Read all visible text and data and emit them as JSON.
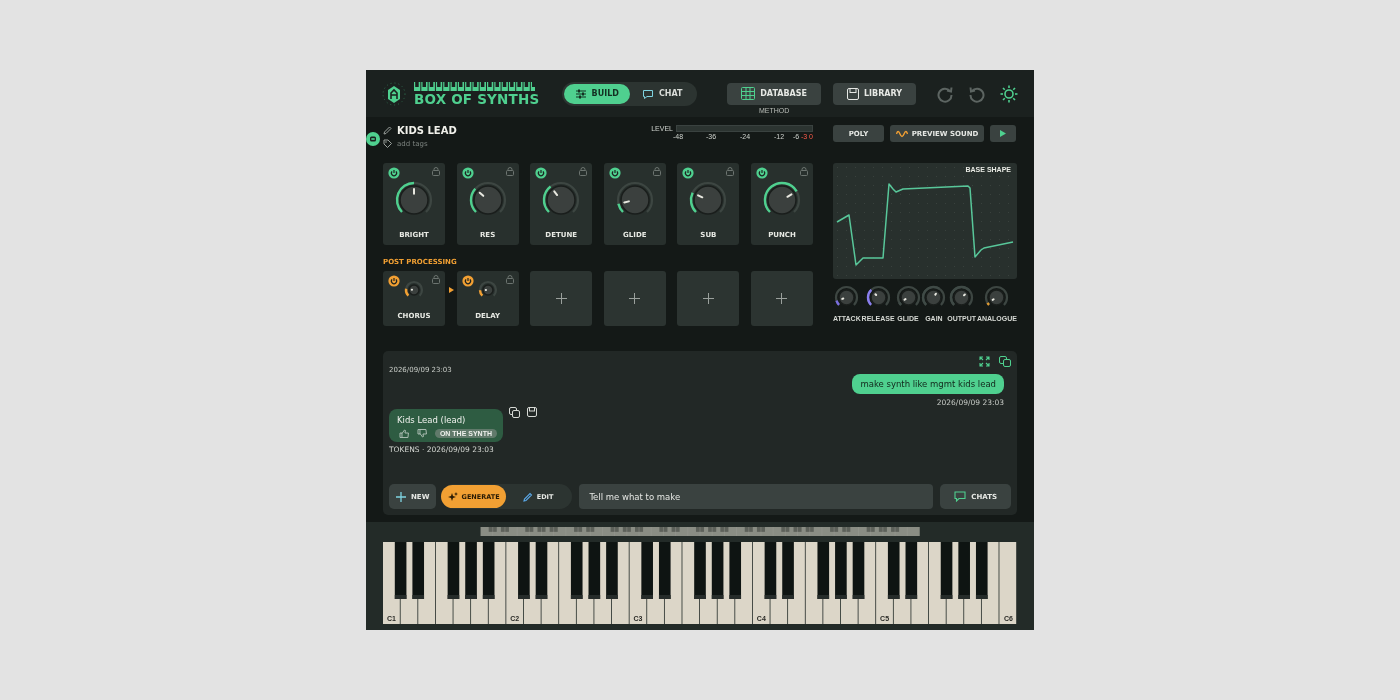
{
  "header": {
    "title": "BOX OF SYNTHS",
    "mode_tabs": [
      {
        "label": "BUILD",
        "selected": true,
        "kind": "build"
      },
      {
        "label": "CHAT",
        "selected": false,
        "kind": "chat"
      }
    ],
    "buttons": [
      {
        "label": "DATABASE",
        "caption": "METHOD",
        "kind": "database"
      },
      {
        "label": "LIBRARY",
        "kind": "library"
      }
    ]
  },
  "patch": {
    "name": "KIDS LEAD",
    "tags_placeholder": "add tags"
  },
  "level_meter": {
    "label": "LEVEL",
    "ticks": [
      {
        "label": "-48",
        "hot": false
      },
      {
        "label": "-36",
        "hot": false
      },
      {
        "label": "-24",
        "hot": false
      },
      {
        "label": "-12",
        "hot": false
      },
      {
        "label": "-6",
        "hot": false
      },
      {
        "label": "-3",
        "hot": true
      },
      {
        "label": "0",
        "hot": true
      }
    ]
  },
  "transport": {
    "voice_mode": "POLY",
    "preview": "PREVIEW SOUND"
  },
  "modules": [
    {
      "label": "BRIGHT",
      "on": true
    },
    {
      "label": "RES",
      "on": true
    },
    {
      "label": "DETUNE",
      "on": true
    },
    {
      "label": "GLIDE",
      "on": true
    },
    {
      "label": "SUB",
      "on": true
    },
    {
      "label": "PUNCH",
      "on": true
    }
  ],
  "post_processing": {
    "title": "POST PROCESSING",
    "slots": [
      {
        "kind": "effect",
        "label": "CHORUS",
        "on": true
      },
      {
        "kind": "effect",
        "label": "DELAY",
        "on": true
      },
      {
        "kind": "empty"
      },
      {
        "kind": "empty"
      },
      {
        "kind": "empty"
      },
      {
        "kind": "empty"
      }
    ]
  },
  "base_shape": {
    "title": "BASE SHAPE"
  },
  "macros": [
    {
      "label": "ATTACK"
    },
    {
      "label": "RELEASE"
    },
    {
      "label": "GLIDE"
    },
    {
      "label": "GAIN"
    },
    {
      "label": "OUTPUT"
    },
    {
      "label": "ANALOGUE"
    }
  ],
  "chat": {
    "older_timestamp": "2026/09/09 23:03",
    "messages": [
      {
        "kind": "user",
        "text": "make synth like mgmt kids lead",
        "time": "2026/09/09 23:03"
      },
      {
        "kind": "assistant",
        "text": "Kids Lead (lead)",
        "badge": "ON THE SYNTH",
        "meta": "TOKENS · 2026/09/09 23:03"
      }
    ],
    "new_button": "NEW",
    "modes": [
      {
        "label": "GENERATE",
        "selected": true,
        "kind": "generate"
      },
      {
        "label": "EDIT",
        "selected": false,
        "kind": "edit"
      }
    ],
    "input_placeholder": "Tell me what to make",
    "chats_button": "CHATS"
  },
  "keyboard": {
    "octave_labels": [
      "C1",
      "C2",
      "C3",
      "C4",
      "C5",
      "C6"
    ]
  }
}
